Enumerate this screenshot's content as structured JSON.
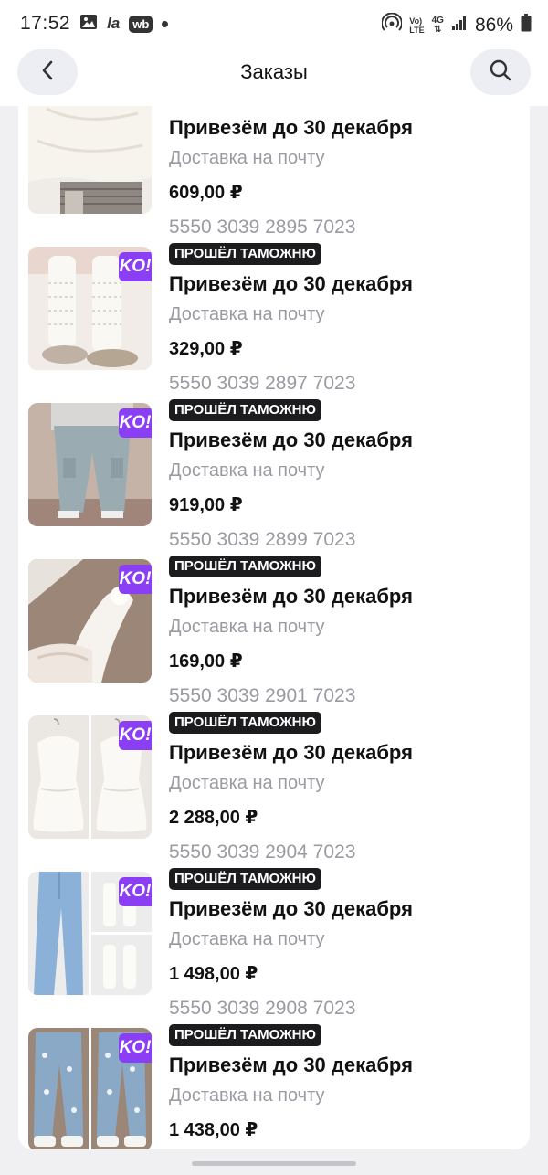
{
  "status_bar": {
    "time": "17:52",
    "notif_text_1": "la",
    "notif_text_2": "wb",
    "net_label_1": "Vo)",
    "net_label_2": "LTE",
    "net_label_3": "4G",
    "battery": "86%"
  },
  "header": {
    "title": "Заказы",
    "back_icon": "chevron-left-icon",
    "search_icon": "search-icon"
  },
  "orders": [
    {
      "track": "",
      "status": "",
      "delivery": "Привезём до 30 декабря",
      "method": "Доставка на почту",
      "price": "609,00 ₽",
      "image": "sweater-and-skirt",
      "badge": ""
    },
    {
      "track": "5550 3039 2895 7023",
      "status": "ПРОШЁЛ ТАМОЖНЮ",
      "delivery": "Привезём до 30 декабря",
      "method": "Доставка на почту",
      "price": "329,00 ₽",
      "image": "knit-leg-warmers",
      "badge": "KO!"
    },
    {
      "track": "5550 3039 2897 7023",
      "status": "ПРОШЁЛ ТАМОЖНЮ",
      "delivery": "Привезём до 30 декабря",
      "method": "Доставка на почту",
      "price": "919,00 ₽",
      "image": "cargo-jeans",
      "badge": "KO!"
    },
    {
      "track": "5550 3039 2899 7023",
      "status": "ПРОШЁЛ ТАМОЖНЮ",
      "delivery": "Привезём до 30 декабря",
      "method": "Доставка на почту",
      "price": "169,00 ₽",
      "image": "white-tights",
      "badge": "KO!"
    },
    {
      "track": "5550 3039 2901 7023",
      "status": "ПРОШЁЛ ТАМОЖНЮ",
      "delivery": "Привезём до 30 декабря",
      "method": "Доставка на почту",
      "price": "2 288,00 ₽",
      "image": "white-peplum-top",
      "badge": "KO!"
    },
    {
      "track": "5550 3039 2904 7023",
      "status": "ПРОШЁЛ ТАМОЖНЮ",
      "delivery": "Привезём до 30 декабря",
      "method": "Доставка на почту",
      "price": "1 498,00 ₽",
      "image": "jeans-and-socks",
      "badge": "KO!"
    },
    {
      "track": "5550 3039 2908 7023",
      "status": "ПРОШЁЛ ТАМОЖНЮ",
      "delivery": "Привезём до 30 декабря",
      "method": "Доставка на почту",
      "price": "1 438,00 ₽",
      "image": "printed-jeans",
      "badge": "KO!"
    }
  ],
  "colors": {
    "badge_purple": "#8b3ff5",
    "customs_badge": "#1c1c1e",
    "muted_text": "#9a9ba2",
    "page_bg": "#f0f0f3"
  }
}
